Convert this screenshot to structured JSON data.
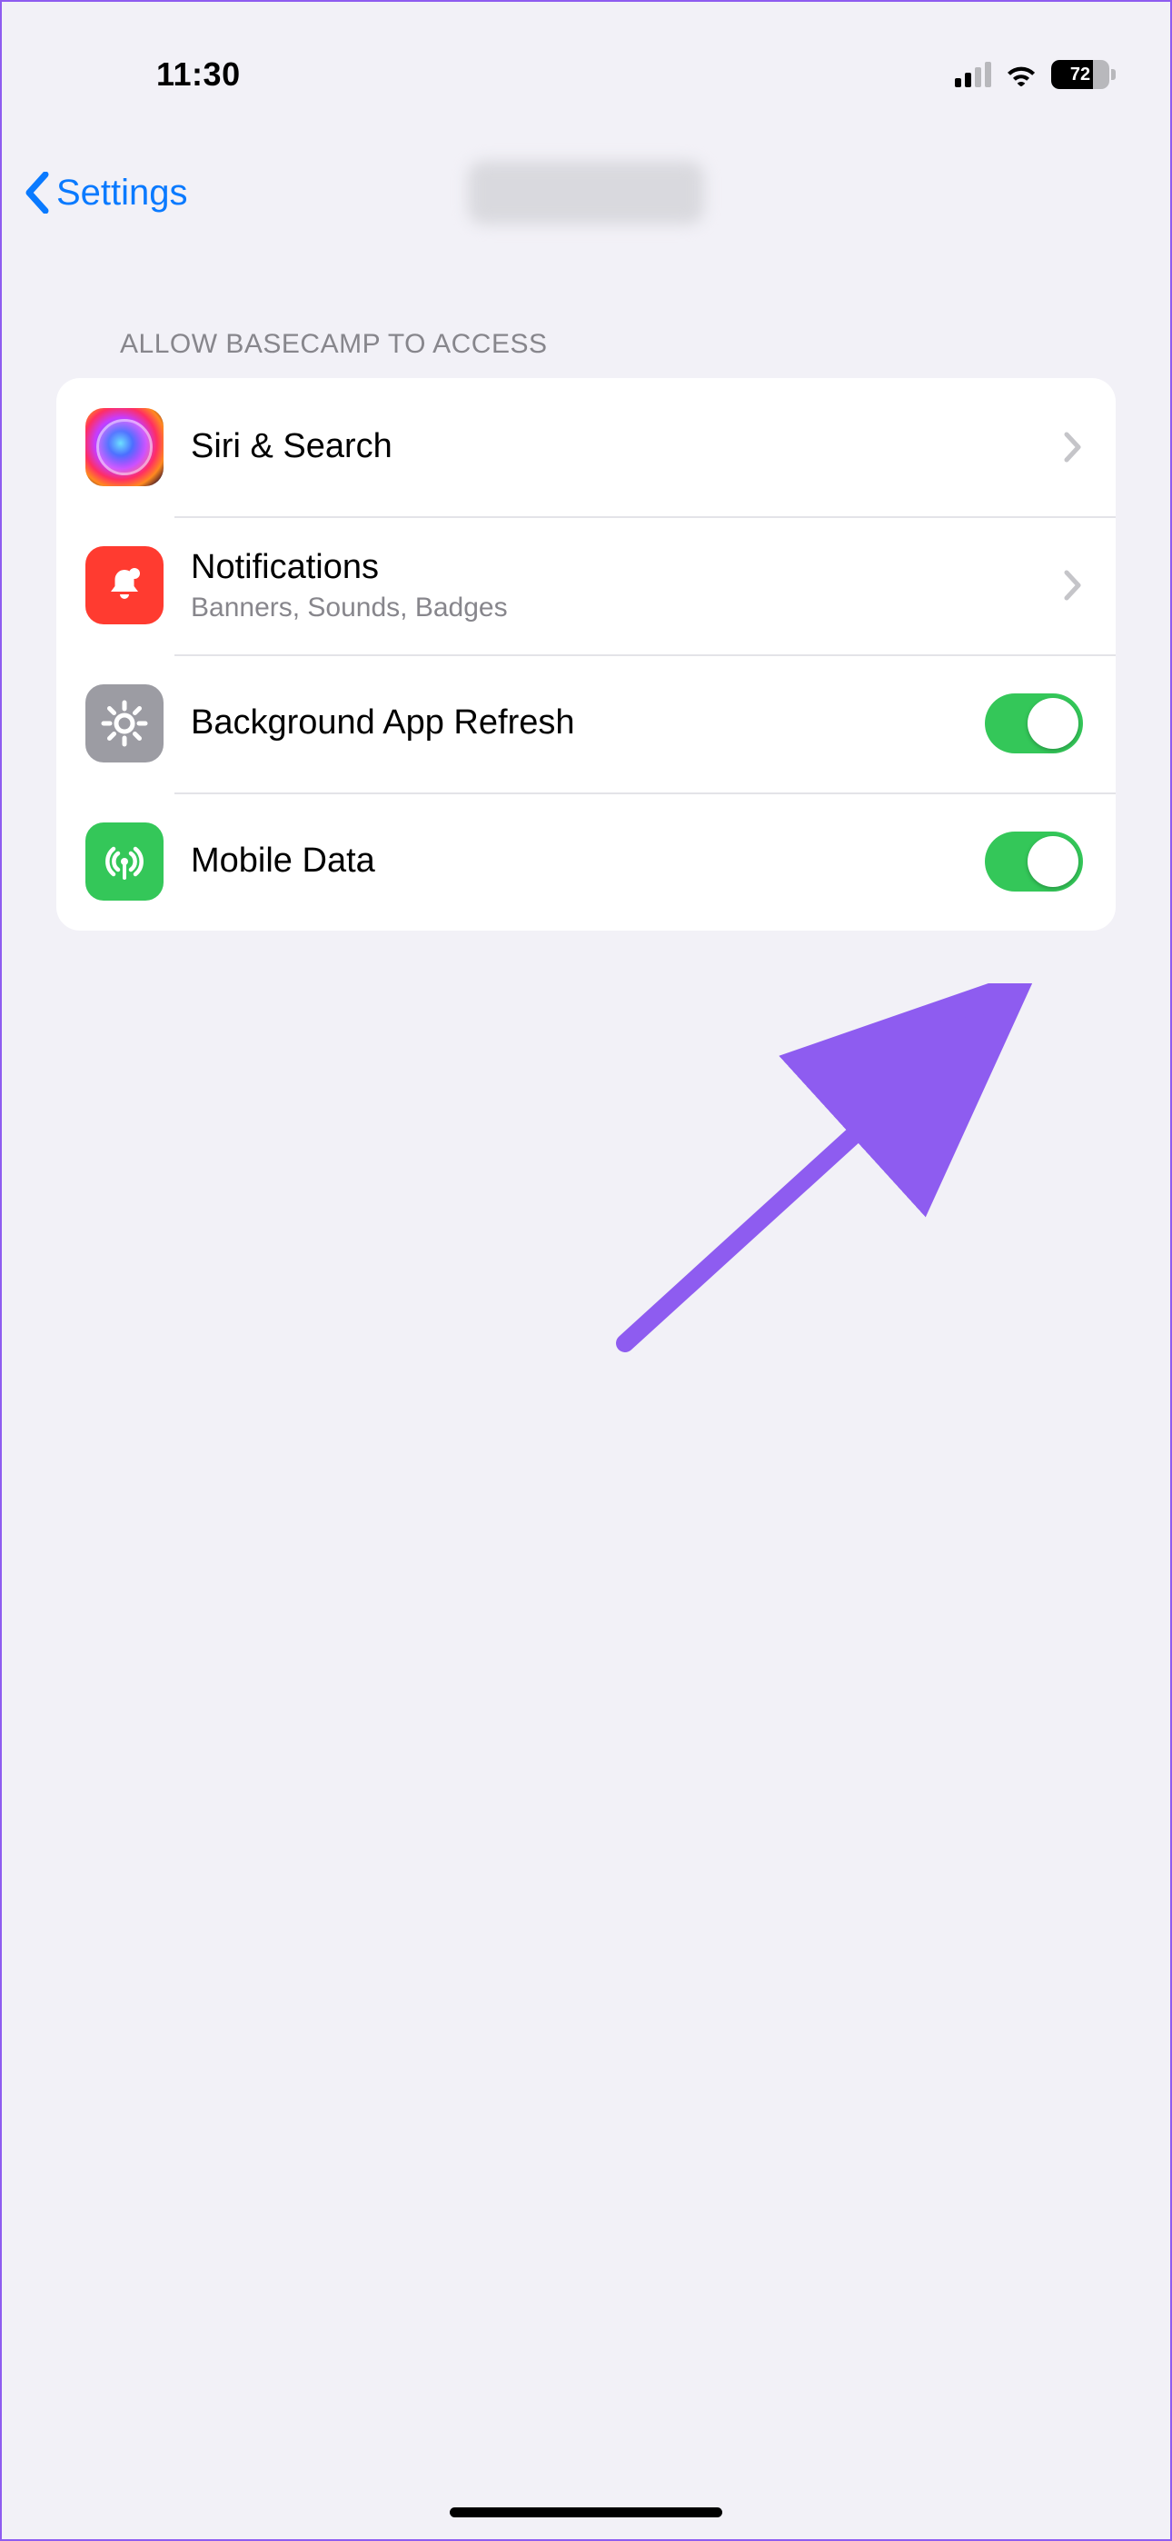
{
  "status": {
    "time": "11:30",
    "battery_percent": "72"
  },
  "nav": {
    "back_label": "Settings"
  },
  "section_header": "Allow Basecamp to Access",
  "rows": {
    "siri": {
      "title": "Siri & Search"
    },
    "notifications": {
      "title": "Notifications",
      "subtitle": "Banners, Sounds, Badges"
    },
    "background_refresh": {
      "title": "Background App Refresh",
      "enabled": true
    },
    "mobile_data": {
      "title": "Mobile Data",
      "enabled": true
    }
  },
  "colors": {
    "accent": "#0a7aff",
    "switch_on": "#34c759",
    "annotation": "#8e5cf0"
  }
}
